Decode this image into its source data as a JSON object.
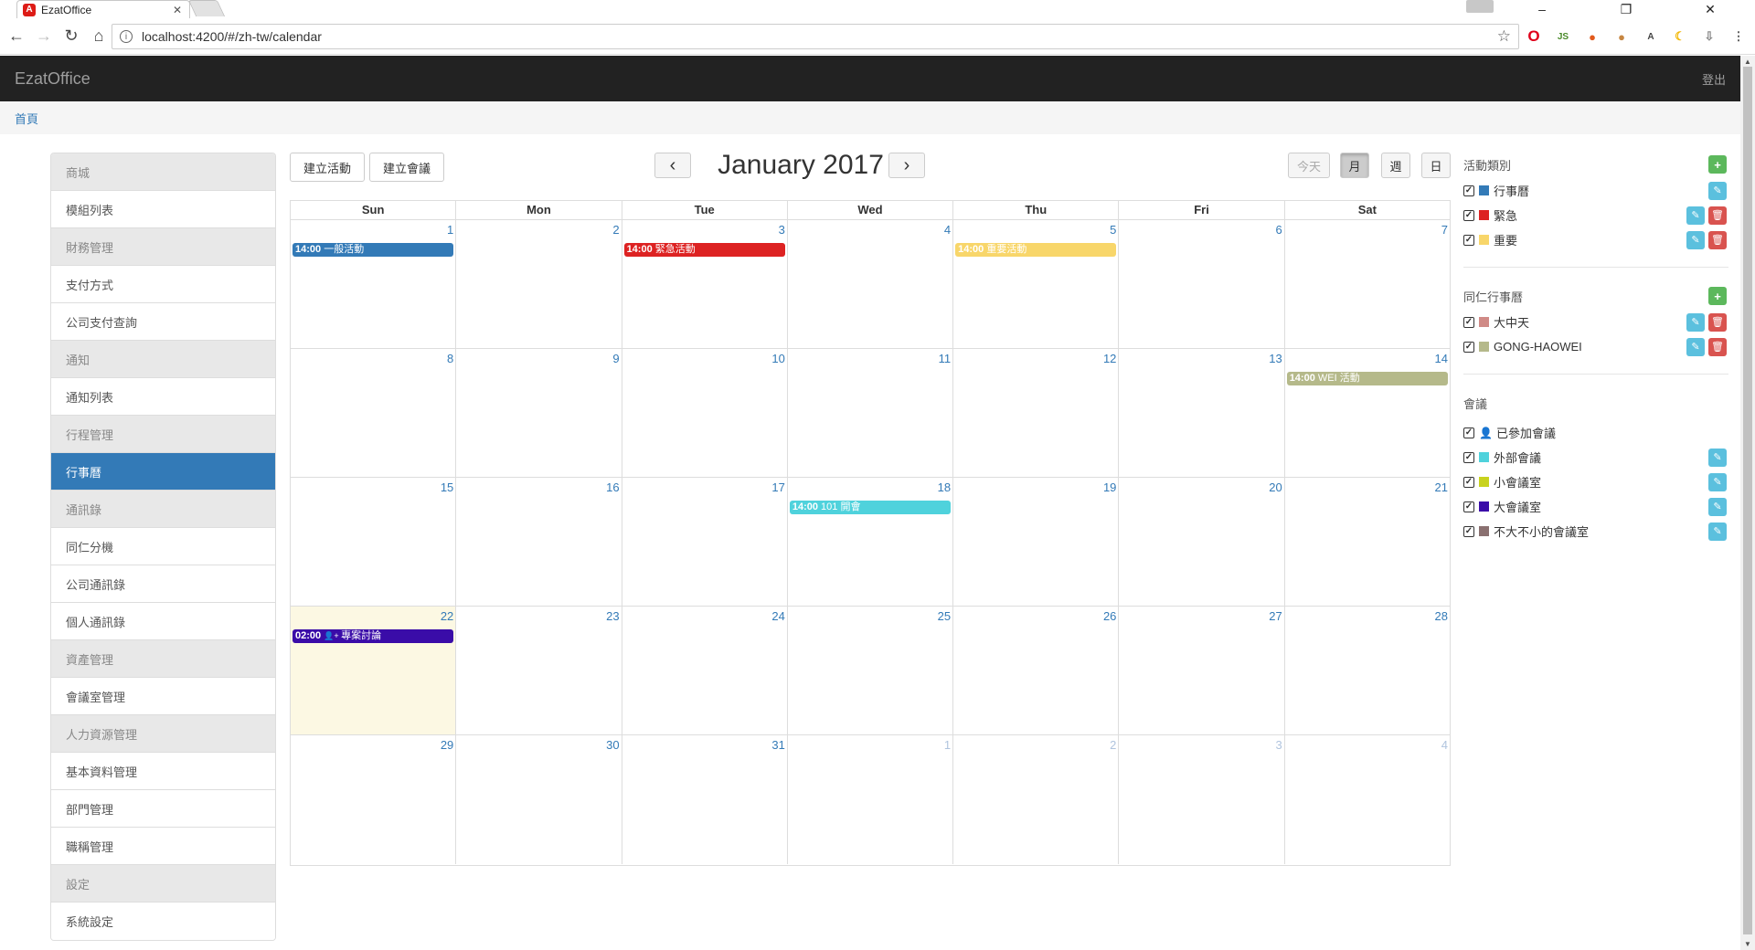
{
  "browser": {
    "tab_title": "EzatOffice",
    "tab_favicon": "A",
    "url": "localhost:4200/#/zh-tw/calendar",
    "window_controls": [
      "–",
      "❐",
      "✕"
    ]
  },
  "navbar": {
    "brand": "EzatOffice",
    "logout": "登出"
  },
  "breadcrumb": {
    "home": "首頁"
  },
  "sidebar": {
    "items": [
      {
        "label": "商城",
        "type": "group"
      },
      {
        "label": "模組列表",
        "type": "item"
      },
      {
        "label": "財務管理",
        "type": "group"
      },
      {
        "label": "支付方式",
        "type": "item"
      },
      {
        "label": "公司支付查詢",
        "type": "item"
      },
      {
        "label": "通知",
        "type": "group"
      },
      {
        "label": "通知列表",
        "type": "item"
      },
      {
        "label": "行程管理",
        "type": "group"
      },
      {
        "label": "行事曆",
        "type": "active"
      },
      {
        "label": "通訊錄",
        "type": "group"
      },
      {
        "label": "同仁分機",
        "type": "item"
      },
      {
        "label": "公司通訊錄",
        "type": "item"
      },
      {
        "label": "個人通訊錄",
        "type": "item"
      },
      {
        "label": "資產管理",
        "type": "group"
      },
      {
        "label": "會議室管理",
        "type": "item"
      },
      {
        "label": "人力資源管理",
        "type": "group"
      },
      {
        "label": "基本資料管理",
        "type": "item"
      },
      {
        "label": "部門管理",
        "type": "item"
      },
      {
        "label": "職稱管理",
        "type": "item"
      },
      {
        "label": "設定",
        "type": "group"
      },
      {
        "label": "系統設定",
        "type": "item"
      }
    ]
  },
  "calendar": {
    "create_event": "建立活動",
    "create_meeting": "建立會議",
    "title": "January 2017",
    "prev": "‹",
    "next": "›",
    "today": "今天",
    "views": {
      "month": "月",
      "week": "週",
      "day": "日"
    },
    "weekdays": [
      "Sun",
      "Mon",
      "Tue",
      "Wed",
      "Thu",
      "Fri",
      "Sat"
    ],
    "weeks": [
      [
        {
          "d": "1"
        },
        {
          "d": "2"
        },
        {
          "d": "3"
        },
        {
          "d": "4"
        },
        {
          "d": "5"
        },
        {
          "d": "6"
        },
        {
          "d": "7"
        }
      ],
      [
        {
          "d": "8"
        },
        {
          "d": "9"
        },
        {
          "d": "10"
        },
        {
          "d": "11"
        },
        {
          "d": "12"
        },
        {
          "d": "13"
        },
        {
          "d": "14"
        }
      ],
      [
        {
          "d": "15"
        },
        {
          "d": "16"
        },
        {
          "d": "17"
        },
        {
          "d": "18"
        },
        {
          "d": "19"
        },
        {
          "d": "20"
        },
        {
          "d": "21"
        }
      ],
      [
        {
          "d": "22",
          "today": true
        },
        {
          "d": "23"
        },
        {
          "d": "24"
        },
        {
          "d": "25"
        },
        {
          "d": "26"
        },
        {
          "d": "27"
        },
        {
          "d": "28"
        }
      ],
      [
        {
          "d": "29"
        },
        {
          "d": "30"
        },
        {
          "d": "31"
        },
        {
          "d": "1",
          "other": true
        },
        {
          "d": "2",
          "other": true
        },
        {
          "d": "3",
          "other": true
        },
        {
          "d": "4",
          "other": true
        }
      ]
    ],
    "events": [
      {
        "week": 0,
        "day": 0,
        "time": "14:00",
        "title": "一般活動",
        "color": "#337ab7"
      },
      {
        "week": 0,
        "day": 2,
        "time": "14:00",
        "title": "緊急活動",
        "color": "#dd2222"
      },
      {
        "week": 0,
        "day": 4,
        "time": "14:00",
        "title": "重要活動",
        "color": "#f8d66a"
      },
      {
        "week": 1,
        "day": 6,
        "time": "14:00",
        "title": "WEI 活動",
        "color": "#b5b98a"
      },
      {
        "week": 2,
        "day": 3,
        "time": "14:00",
        "title": "101 開會",
        "color": "#4fd2dc"
      },
      {
        "week": 3,
        "day": 0,
        "time": "02:00",
        "title": "專案討論",
        "color": "#3a0ca8",
        "icon": "user-plus-icon"
      }
    ]
  },
  "filters": {
    "event_types": {
      "title": "活動類別",
      "items": [
        {
          "label": "行事曆",
          "color": "#337ab7",
          "edit": true,
          "delete": false
        },
        {
          "label": "緊急",
          "color": "#dd2222",
          "edit": true,
          "delete": true
        },
        {
          "label": "重要",
          "color": "#f8d66a",
          "edit": true,
          "delete": true
        }
      ]
    },
    "colleagues": {
      "title": "同仁行事曆",
      "items": [
        {
          "label": "大中天",
          "color": "#d08a86",
          "edit": true,
          "delete": true
        },
        {
          "label": "GONG-HAOWEI",
          "color": "#b5b98a",
          "edit": true,
          "delete": true
        }
      ]
    },
    "meetings": {
      "title": "會議",
      "items": [
        {
          "label": "已參加會議",
          "color": null,
          "icon": "user-plus-icon",
          "edit": false,
          "delete": false
        },
        {
          "label": "外部會議",
          "color": "#4fd2dc",
          "edit": true,
          "delete": false
        },
        {
          "label": "小會議室",
          "color": "#c8d21e",
          "edit": true,
          "delete": false
        },
        {
          "label": "大會議室",
          "color": "#3a0ca8",
          "edit": true,
          "delete": false
        },
        {
          "label": "不大不小的會議室",
          "color": "#8a7070",
          "edit": true,
          "delete": false
        }
      ]
    }
  }
}
